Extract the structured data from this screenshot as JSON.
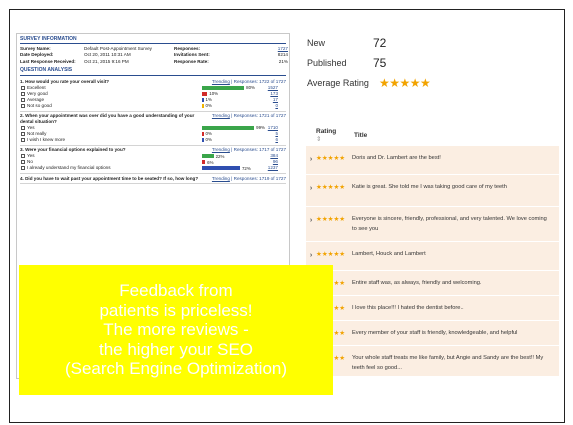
{
  "promo": {
    "lines": [
      "Feedback from",
      "patients is priceless!",
      "The more reviews -",
      "the higher your SEO",
      "(Search Engine Optimization)"
    ]
  },
  "survey": {
    "header": "SURVEY INFORMATION",
    "info": {
      "name_label": "Survey Name:",
      "name_value": "Default Post-Appointment Survey",
      "deployed_label": "Date Deployed:",
      "deployed_value": "Oct 20, 2011 10:31 AM",
      "last_label": "Last Response Received:",
      "last_value": "Oct 21, 2015 9:16 PM",
      "responses_label": "Responses:",
      "responses_value": "1727",
      "invitations_label": "Invitations Sent:",
      "invitations_value": "8214",
      "rate_label": "Response Rate:",
      "rate_value": "21%"
    },
    "analysis_header": "QUESTION ANALYSIS",
    "trending_label": "Trending",
    "questions": [
      {
        "text": "1. How would you rate your overall visit?",
        "responses": "| Responses: 1722 of 1727",
        "options": [
          {
            "label": "Excellent",
            "percent": 80,
            "pct_text": "80%",
            "count": "1527",
            "color": "#3aa54a"
          },
          {
            "label": "Very good",
            "percent": 10,
            "pct_text": "10%",
            "count": "173",
            "color": "#d22b2b"
          },
          {
            "label": "Average",
            "percent": 1,
            "pct_text": "1%",
            "count": "17",
            "color": "#2f4fb0"
          },
          {
            "label": "Not so good",
            "percent": 0,
            "pct_text": "0%",
            "count": "0",
            "color": "#f0b400"
          }
        ]
      },
      {
        "text": "2. When your appointment was over did you have a good understanding of your dental situation?",
        "responses": "| Responses: 1721 of 1727",
        "options": [
          {
            "label": "Yes",
            "percent": 99,
            "pct_text": "99%",
            "count": "1710",
            "color": "#3aa54a"
          },
          {
            "label": "Not really",
            "percent": 0,
            "pct_text": "0%",
            "count": "5",
            "color": "#d22b2b"
          },
          {
            "label": "I wish I knew more",
            "percent": 0,
            "pct_text": "0%",
            "count": "6",
            "color": "#2f4fb0"
          }
        ]
      },
      {
        "text": "3. Were your financial options explained to you?",
        "responses": "| Responses: 1717 of 1727",
        "options": [
          {
            "label": "Yes",
            "percent": 22,
            "pct_text": "22%",
            "count": "384",
            "color": "#3aa54a"
          },
          {
            "label": "No",
            "percent": 6,
            "pct_text": "6%",
            "count": "96",
            "color": "#d22b2b"
          },
          {
            "label": "I already understand my financial options",
            "percent": 72,
            "pct_text": "72%",
            "count": "1237",
            "color": "#2f4fb0"
          }
        ]
      },
      {
        "text": "4. Did you have to wait past your appointment time to be seated? If so, how long?",
        "responses": "| Responses: 1719 of 1727",
        "options": []
      }
    ]
  },
  "reviews": {
    "new_label": "New",
    "new_value": "72",
    "published_label": "Published",
    "published_value": "75",
    "average_label": "Average Rating",
    "average_stars": "★★★★★",
    "col_rating": "Rating",
    "col_sort": "⇕",
    "col_title": "Title",
    "rows": [
      {
        "stars": "★★★★★",
        "title": "Doris and Dr. Lambert are the best!"
      },
      {
        "stars": "★★★★★",
        "title": "Katie is great. She told me I was taking good care of my teeth"
      },
      {
        "stars": "★★★★★",
        "title": "Everyone is sincere, friendly, professional, and very talented. We love coming to see you"
      },
      {
        "stars": "★★★★★",
        "title": "Lambert, Houck and Lambert"
      },
      {
        "stars": "★★★★★",
        "title": "Entire staff was, as always, friendly and welcoming."
      },
      {
        "stars": "★★★★★",
        "title": "I love this place!!! I hated the dentist before.."
      },
      {
        "stars": "★★★★★",
        "title": "Every member of your staff is friendly, knowledgeable, and helpful"
      },
      {
        "stars": "★★★★★",
        "title": "Your whole staff treats me like family, but Angie and Sandy are the best!! My teeth feel so good..."
      }
    ]
  }
}
